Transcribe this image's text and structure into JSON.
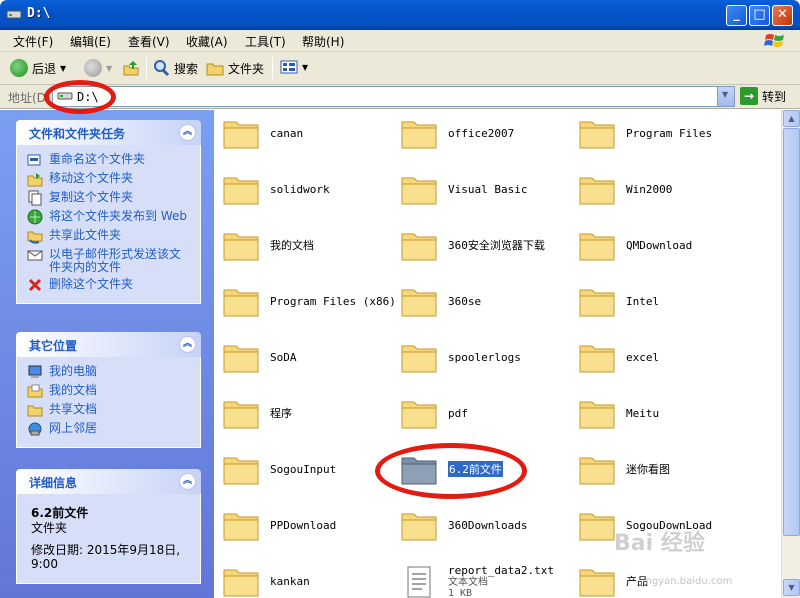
{
  "window": {
    "title": "D:\\"
  },
  "menu": [
    "文件(F)",
    "编辑(E)",
    "查看(V)",
    "收藏(A)",
    "工具(T)",
    "帮助(H)"
  ],
  "toolbar": {
    "back": "后退",
    "search": "搜索",
    "folders": "文件夹"
  },
  "address": {
    "label": "地址(D)",
    "value": "D:\\",
    "go": "转到"
  },
  "tasks": {
    "title": "文件和文件夹任务",
    "items": [
      "重命名这个文件夹",
      "移动这个文件夹",
      "复制这个文件夹",
      "将这个文件夹发布到 Web",
      "共享此文件夹",
      "以电子邮件形式发送该文件夹内的文件",
      "删除这个文件夹"
    ]
  },
  "other_places": {
    "title": "其它位置",
    "items": [
      "我的电脑",
      "我的文档",
      "共享文档",
      "网上邻居"
    ]
  },
  "details": {
    "title": "详细信息",
    "name": "6.2前文件",
    "type": "文件夹",
    "modified": "修改日期: 2015年9月18日, 9:00"
  },
  "files": [
    "canan",
    "office2007",
    "Program Files",
    "solidwork",
    "Visual Basic",
    "Win2000",
    "我的文档",
    "360安全浏览器下载",
    "QMDownload",
    "Program Files (x86)",
    "360se",
    "Intel",
    "SoDA",
    "spoolerlogs",
    "excel",
    "程序",
    "pdf",
    "Meitu",
    "SogouInput",
    "6.2前文件",
    "迷你看图",
    "PPDownload",
    "360Downloads",
    "SogouDownLoad",
    "kankan",
    "report_data2.txt",
    "产品"
  ],
  "file_extra": {
    "txt_type": "文本文档",
    "txt_size": "1 KB"
  },
  "watermark": {
    "main": "Bai 经验",
    "sub": "jingyan.baidu.com"
  }
}
